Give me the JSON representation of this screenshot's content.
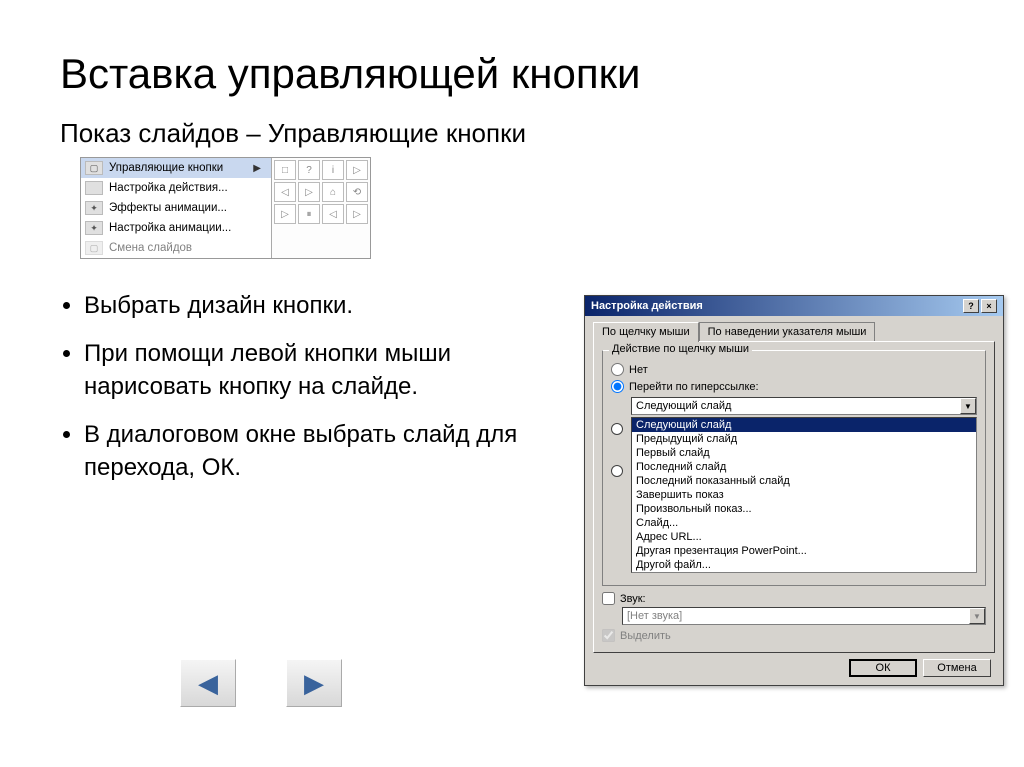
{
  "title": "Вставка управляющей кнопки",
  "subtitle": "Показ слайдов – Управляющие кнопки",
  "menu": {
    "items": [
      {
        "label": "Управляющие кнопки",
        "selected": true,
        "arrow": true
      },
      {
        "label": "Настройка действия..."
      },
      {
        "label": "Эффекты анимации..."
      },
      {
        "label": "Настройка анимации..."
      },
      {
        "label": "Смена слайдов"
      }
    ]
  },
  "shapes": [
    "□",
    "?",
    "i",
    "▷",
    "◁",
    "▷",
    "⌂",
    "⟲",
    "▷",
    "⏸",
    "◁",
    "▷"
  ],
  "bullets": [
    "Выбрать дизайн кнопки.",
    "При помощи левой кнопки мыши нарисовать кнопку на слайде.",
    "В диалоговом окне выбрать слайд для перехода,  ОК."
  ],
  "dialog": {
    "title": "Настройка действия",
    "help": "?",
    "close": "×",
    "tab1": "По щелчку мыши",
    "tab2": "По наведении указателя мыши",
    "group_legend": "Действие по щелчку мыши",
    "radio_none": "Нет",
    "radio_link": "Перейти по гиперссылке:",
    "combo_value": "Следующий слайд",
    "list": [
      "Следующий слайд",
      "Предыдущий слайд",
      "Первый слайд",
      "Последний слайд",
      "Последний показанный слайд",
      "Завершить показ",
      "Произвольный показ...",
      "Слайд...",
      "Адрес URL...",
      "Другая презентация PowerPoint...",
      "Другой файл..."
    ],
    "sound_label": "Звук:",
    "sound_value": "[Нет звука]",
    "highlight_label": "Выделить",
    "ok": "ОК",
    "cancel": "Отмена"
  },
  "nav": {
    "prev": "◀",
    "next": "▶"
  }
}
